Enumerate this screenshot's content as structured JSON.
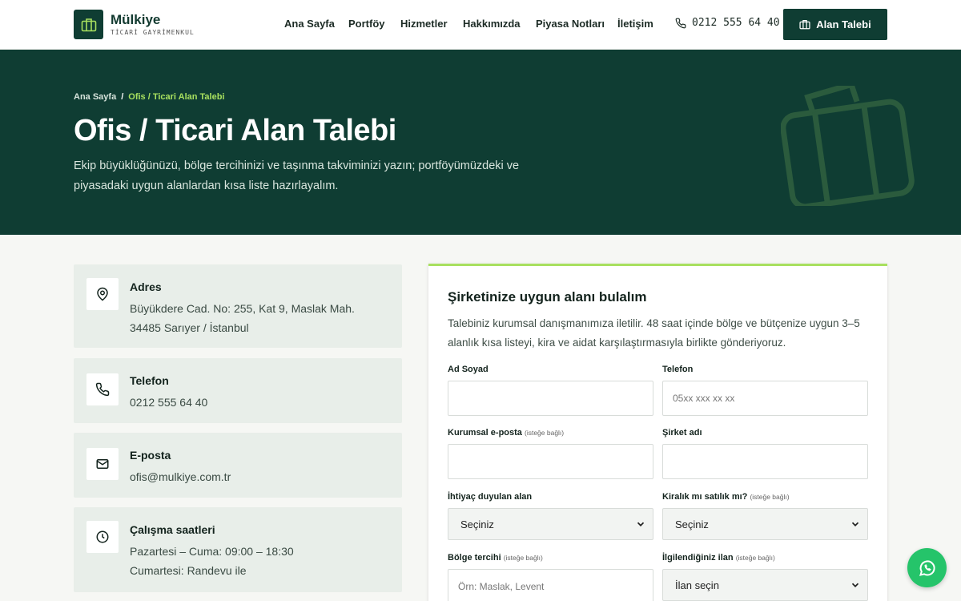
{
  "brand": {
    "name": "Mülkiye",
    "tagline": "TİCARİ GAYRİMENKUL"
  },
  "nav": [
    "Ana Sayfa",
    "Portföy",
    "Hizmetler",
    "Hakkımızda",
    "Piyasa Notları",
    "İletişim"
  ],
  "header": {
    "phone": "0212 555 64 40",
    "cta_label": "Alan Talebi"
  },
  "hero": {
    "breadcrumb_home": "Ana Sayfa",
    "breadcrumb_sep": "/",
    "breadcrumb_current": "Ofis / Ticari Alan Talebi",
    "title": "Ofis / Ticari Alan Talebi",
    "description": "Ekip büyüklüğünüzü, bölge tercihinizi ve taşınma takviminizi yazın; portföyümüzdeki ve piyasadaki uygun alanlardan kısa liste hazırlayalım."
  },
  "contact": [
    {
      "title": "Adres",
      "lines": [
        "Büyükdere Cad. No: 255, Kat 9, Maslak Mah.",
        "34485 Sarıyer / İstanbul"
      ],
      "icon": "map-pin-icon"
    },
    {
      "title": "Telefon",
      "lines": [
        "0212 555 64 40"
      ],
      "icon": "phone-icon"
    },
    {
      "title": "E-posta",
      "lines": [
        "ofis@mulkiye.com.tr"
      ],
      "icon": "mail-icon"
    },
    {
      "title": "Çalışma saatleri",
      "lines": [
        "Pazartesi – Cuma: 09:00 – 18:30",
        "Cumartesi: Randevu ile"
      ],
      "icon": "clock-icon"
    }
  ],
  "form": {
    "title": "Şirketinize uygun alanı bulalım",
    "description": "Talebiniz kurumsal danışmanımıza iletilir. 48 saat içinde bölge ve bütçenize uygun 3–5 alanlık kısa listeyi, kira ve aidat karşılaştırmasıyla birlikte gönderiyoruz.",
    "optional_tag": "(isteğe bağlı)",
    "name_label": "Ad Soyad",
    "phone_label": "Telefon",
    "phone_placeholder": "05xx xxx xx xx",
    "email_label": "Kurumsal e-posta",
    "company_label": "Şirket adı",
    "need_label": "İhtiyaç duyulan alan",
    "need_value": "Seçiniz",
    "rent_label": "Kiralık mı satılık mı?",
    "rent_value": "Seçiniz",
    "region_label": "Bölge tercihi",
    "region_placeholder": "Örn: Maslak, Levent",
    "listing_label": "İlgilendiğiniz ilan",
    "listing_value": "İlan seçin"
  },
  "colors": {
    "primary": "#0f3d33",
    "accent": "#a8e05f",
    "whatsapp": "#25c46a"
  }
}
